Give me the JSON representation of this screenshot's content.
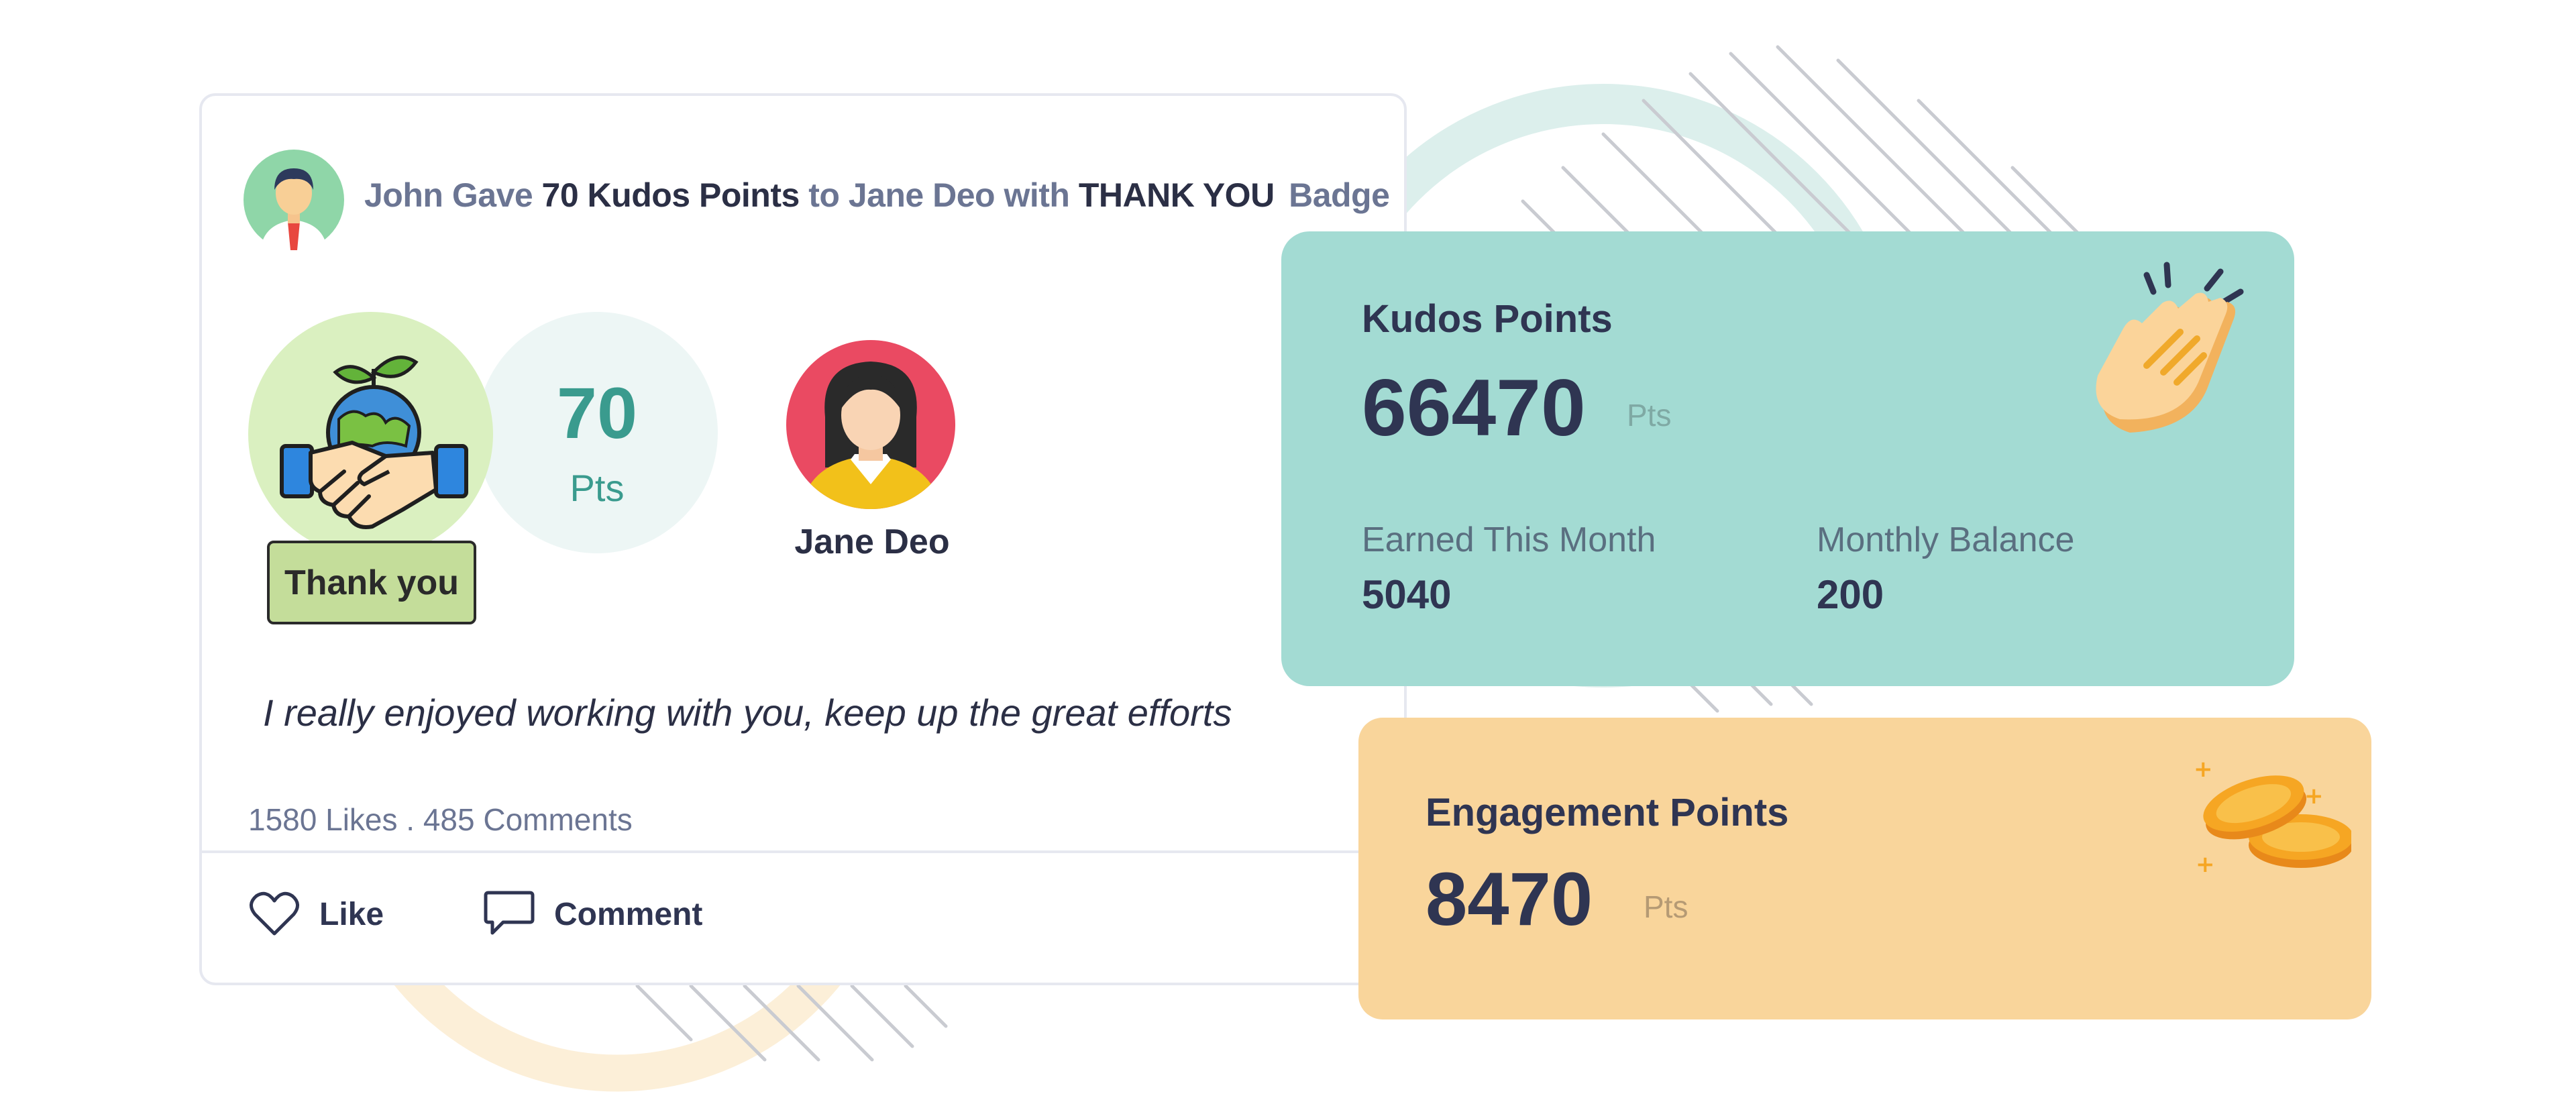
{
  "post": {
    "headline": {
      "giver": "John Gave",
      "points": "70 Kudos Points",
      "to": "to Jane Deo with",
      "badge_name": "THANK YOU",
      "badge_word": "Badge"
    },
    "points_value": "70",
    "points_unit": "Pts",
    "badge_label": "Thank you",
    "recipient_name": "Jane Deo",
    "message": "I really enjoyed working with you, keep up the great efforts",
    "stats": "1580 Likes . 485 Comments",
    "actions": {
      "like_label": "Like",
      "comment_label": "Comment"
    },
    "icons": [
      "user-avatar-icon",
      "handshake-globe-icon",
      "female-avatar-icon",
      "heart-icon",
      "comment-bubble-icon"
    ]
  },
  "kudos": {
    "title": "Kudos Points",
    "value": "66470",
    "unit": "Pts",
    "earned_label": "Earned This Month",
    "earned_value": "5040",
    "balance_label": "Monthly Balance",
    "balance_value": "200",
    "icon": "clapping-hands-icon"
  },
  "engagement": {
    "title": "Engagement Points",
    "value": "8470",
    "unit": "Pts",
    "icon": "coins-icon"
  },
  "colors": {
    "kudos_card": "#a3dbd3",
    "engagement_card": "#f9d59b",
    "badge_circle": "#daf0c0",
    "badge_tag": "#c4dd9a",
    "points_accent": "#3a9b8e",
    "text_dark": "#2f3552",
    "text_muted": "#6b7593"
  }
}
